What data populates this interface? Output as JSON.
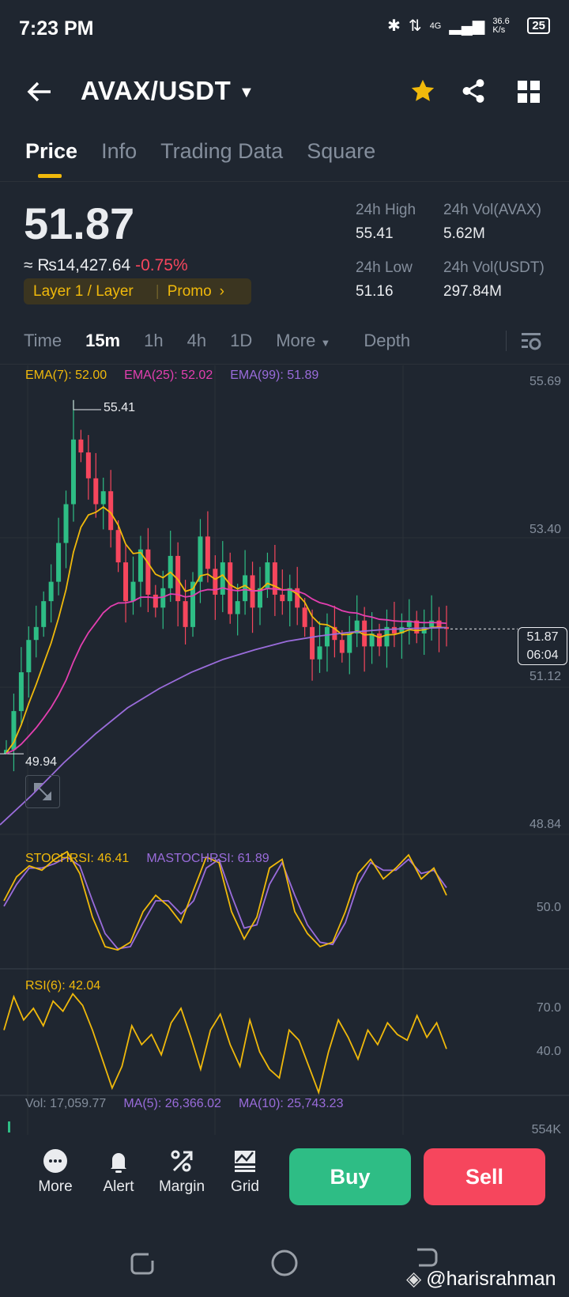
{
  "status_bar": {
    "time": "7:23 PM",
    "net_speed": "36.6 K/s",
    "network": "4G",
    "battery": "25"
  },
  "header": {
    "pair": "AVAX/USDT"
  },
  "tabs": [
    "Price",
    "Info",
    "Trading Data",
    "Square"
  ],
  "ticker": {
    "last_price": "51.87",
    "fiat": "≈ ₨14,427.64",
    "change": "-0.75%",
    "tag": "Layer 1 / Layer",
    "promo": "Promo",
    "high_label": "24h High",
    "high": "55.41",
    "low_label": "24h Low",
    "low": "51.16",
    "vol_base_label": "24h Vol(AVAX)",
    "vol_base": "5.62M",
    "vol_quote_label": "24h Vol(USDT)",
    "vol_quote": "297.84M"
  },
  "timeframes": {
    "items": [
      "Time",
      "15m",
      "1h",
      "4h",
      "1D"
    ],
    "more": "More",
    "depth": "Depth",
    "active": "15m"
  },
  "colors": {
    "up": "#2ebd85",
    "down": "#f6465d",
    "accent": "#f0b90b",
    "ema7": "#f0b90b",
    "ema25": "#e33fb0",
    "ema99": "#9a6cdb"
  },
  "indicators": {
    "ema7": "EMA(7): 52.00",
    "ema25": "EMA(25): 52.02",
    "ema99": "EMA(99): 51.89",
    "stoch": "STOCHRSI: 46.41",
    "mastoch": "MASTOCHRSI: 61.89",
    "rsi": "RSI(6): 42.04",
    "vol": "Vol: 17,059.77",
    "ma5": "MA(5): 26,366.02",
    "ma10": "MA(10): 25,743.23"
  },
  "chart_data": {
    "type": "candlestick",
    "price_axis": [
      "55.69",
      "53.40",
      "51.12",
      "48.84"
    ],
    "ylim": [
      48.84,
      55.69
    ],
    "high_marker": "55.41",
    "low_marker": "49.94",
    "last_price": "51.87",
    "countdown": "06:04",
    "start_open": 49.94,
    "closes": [
      50.0,
      50.6,
      51.2,
      51.7,
      51.9,
      52.3,
      52.6,
      53.2,
      53.8,
      54.8,
      54.6,
      54.2,
      53.8,
      54.0,
      53.4,
      52.9,
      52.3,
      52.6,
      53.1,
      52.4,
      52.2,
      52.5,
      53.0,
      52.3,
      51.9,
      52.6,
      53.3,
      52.8,
      52.4,
      52.9,
      52.1,
      52.3,
      52.7,
      52.2,
      52.5,
      52.9,
      52.4,
      52.3,
      52.5,
      52.2,
      51.9,
      51.4,
      51.6,
      51.9,
      51.7,
      51.5,
      51.8,
      52.0,
      51.6,
      51.8,
      51.6,
      51.9,
      51.8,
      51.9,
      52.0,
      51.8,
      51.9,
      52.0,
      51.9,
      51.87
    ],
    "ema99": [
      48.84,
      49.3,
      49.8,
      50.25,
      50.65,
      50.95,
      51.2,
      51.4,
      51.55,
      51.68,
      51.76,
      51.82,
      51.86,
      51.88,
      51.89
    ],
    "stoch_axis": "50.0",
    "stochrsi": [
      50,
      72,
      82,
      78,
      88,
      95,
      75,
      35,
      8,
      5,
      12,
      40,
      55,
      45,
      30,
      60,
      90,
      85,
      40,
      15,
      35,
      80,
      88,
      40,
      20,
      8,
      12,
      40,
      75,
      88,
      70,
      80,
      92,
      70,
      80,
      55
    ],
    "mastochrsi": [
      45,
      65,
      80,
      80,
      84,
      90,
      82,
      50,
      20,
      6,
      8,
      30,
      50,
      50,
      38,
      50,
      80,
      88,
      55,
      25,
      28,
      65,
      85,
      55,
      28,
      12,
      10,
      30,
      65,
      85,
      78,
      78,
      88,
      75,
      78,
      62
    ],
    "rsi_axis": [
      "70.0",
      "40.0"
    ],
    "rsi": [
      55,
      78,
      62,
      70,
      58,
      75,
      68,
      80,
      72,
      55,
      35,
      15,
      30,
      58,
      45,
      52,
      38,
      60,
      70,
      50,
      28,
      55,
      66,
      45,
      30,
      62,
      40,
      28,
      22,
      55,
      48,
      30,
      12,
      40,
      62,
      50,
      35,
      55,
      45,
      60,
      52,
      48,
      65,
      50,
      60,
      42
    ],
    "vol_axis": "554K"
  },
  "bottom_bar": {
    "more": "More",
    "alert": "Alert",
    "margin": "Margin",
    "grid": "Grid",
    "buy": "Buy",
    "sell": "Sell"
  },
  "watermark": "@harisrahman"
}
